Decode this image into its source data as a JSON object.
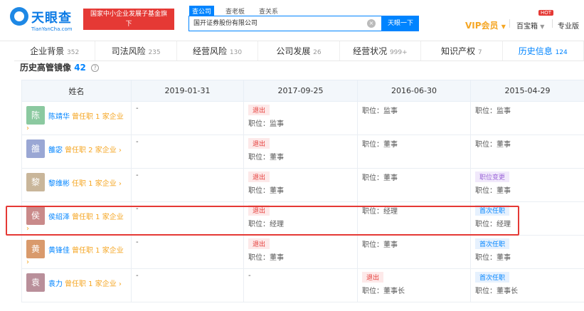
{
  "header": {
    "logo_text": "天眼查",
    "logo_url": "TianYanCha.com",
    "badge_line1": "国家中小企业发展子基金旗下",
    "badge_line2": "官方备案企业征信机构",
    "search_tabs": [
      "查公司",
      "查老板",
      "查关系"
    ],
    "search_value": "国开证券股份有限公司",
    "search_button": "天眼一下",
    "vip": "VIP会员",
    "baibao": "百宝箱",
    "hot": "HOT",
    "pro": "专业版"
  },
  "tabs": [
    {
      "label": "企业背景",
      "count": "352"
    },
    {
      "label": "司法风险",
      "count": "235"
    },
    {
      "label": "经营风险",
      "count": "130"
    },
    {
      "label": "公司发展",
      "count": "26"
    },
    {
      "label": "经营状况",
      "count": "999+"
    },
    {
      "label": "知识产权",
      "count": "7"
    },
    {
      "label": "历史信息",
      "count": "124"
    }
  ],
  "section": {
    "title": "历史高管镜像",
    "count": "42",
    "help": "?"
  },
  "table": {
    "headers": [
      "姓名",
      "2019-01-31",
      "2017-09-25",
      "2016-06-30",
      "2015-04-29"
    ],
    "rows": [
      {
        "avatar": "陈",
        "color": "#8bc9a0",
        "name": "陈靖华",
        "note": "曾任职 1 家企业 ›",
        "c1": {
          "text": "-"
        },
        "c2": {
          "tag": "退出",
          "pos": "职位：监事"
        },
        "c3": {
          "pos": "职位：监事"
        },
        "c4": {
          "pos": "职位：监事"
        }
      },
      {
        "avatar": "雒",
        "color": "#9aa7d4",
        "name": "雒宓",
        "note": "曾任职 2 家企业 ›",
        "c1": {
          "text": "-"
        },
        "c2": {
          "tag": "退出",
          "pos": "职位：董事"
        },
        "c3": {
          "pos": "职位：董事"
        },
        "c4": {
          "pos": "职位：董事"
        }
      },
      {
        "avatar": "黎",
        "color": "#c9b69a",
        "name": "黎维彬",
        "note": "任职 1 家企业 ›",
        "c1": {
          "text": "-"
        },
        "c2": {
          "tag": "退出",
          "pos": "职位：董事"
        },
        "c3": {
          "pos": "职位：董事"
        },
        "c4": {
          "tag": "职位变更",
          "pos": "职位：董事"
        }
      },
      {
        "avatar": "侯",
        "color": "#c98a8a",
        "name": "侯绍泽",
        "note": "曾任职 1 家企业 ›",
        "c1": {
          "text": "-"
        },
        "c2": {
          "tag": "退出",
          "pos": "职位：经理"
        },
        "c3": {
          "pos": "职位：经理"
        },
        "c4": {
          "tag": "首次任职",
          "pos": "职位：经理"
        }
      },
      {
        "avatar": "黄",
        "color": "#d99a6c",
        "name": "黄锋佳",
        "note": "曾任职 1 家企业 ›",
        "c1": {
          "text": "-"
        },
        "c2": {
          "tag": "退出",
          "pos": "职位：董事"
        },
        "c3": {
          "pos": "职位：董事"
        },
        "c4": {
          "tag": "首次任职",
          "pos": "职位：董事"
        }
      },
      {
        "avatar": "袁",
        "color": "#b98f9a",
        "name": "袁力",
        "note": "曾任职 1 家企业 ›",
        "c1": {
          "text": "-"
        },
        "c2": {
          "text": "-"
        },
        "c3": {
          "tag": "退出",
          "pos": "职位：董事长"
        },
        "c4": {
          "tag": "首次任职",
          "pos": "职位：董事长"
        }
      }
    ]
  }
}
